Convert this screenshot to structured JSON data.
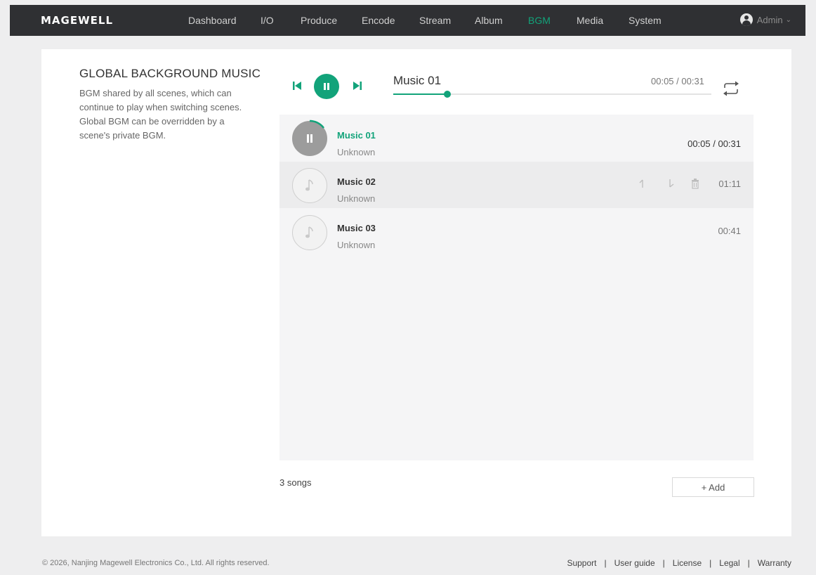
{
  "brand": {
    "logo": "MAGEWELL",
    "accent": "#12a37a"
  },
  "nav": {
    "items": [
      "Dashboard",
      "I/O",
      "Produce",
      "Encode",
      "Stream",
      "Album",
      "BGM",
      "Media",
      "System"
    ],
    "active": "BGM",
    "user": "Admin"
  },
  "intro": {
    "title": "GLOBAL BACKGROUND MUSIC",
    "description": "BGM shared by all scenes, which can continue to play when switching scenes. Global BGM can be overridden by a scene's private BGM."
  },
  "player": {
    "now_playing": "Music 01",
    "elapsed": "00:05",
    "total": "00:31",
    "time_display": "00:05 / 00:31",
    "progress_fraction": 0.17,
    "state": "playing",
    "icons": [
      "skip-previous-icon",
      "pause-icon",
      "skip-next-icon",
      "repeat-icon"
    ]
  },
  "playlist": {
    "tracks": [
      {
        "name": "Music 01",
        "artist": "Unknown",
        "duration": "00:05 / 00:31",
        "state": "playing"
      },
      {
        "name": "Music 02",
        "artist": "Unknown",
        "duration": "01:11",
        "state": "hover"
      },
      {
        "name": "Music 03",
        "artist": "Unknown",
        "duration": "00:41",
        "state": "idle"
      }
    ],
    "row_action_icons": [
      "move-up-icon",
      "move-down-icon",
      "delete-icon"
    ],
    "count_label": "3 songs",
    "add_label": "+ Add"
  },
  "footer": {
    "copyright": "© 2026, Nanjing Magewell Electronics Co., Ltd. All rights reserved.",
    "links": [
      "Support",
      "User guide",
      "License",
      "Legal",
      "Warranty"
    ]
  }
}
